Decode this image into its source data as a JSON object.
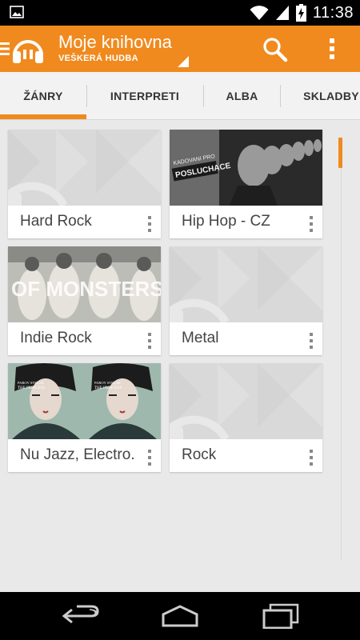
{
  "status_bar": {
    "time": "11:38",
    "icons": [
      "image-notification-icon",
      "wifi-icon",
      "cell-signal-icon",
      "battery-icon"
    ]
  },
  "action_bar": {
    "title": "Moje knihovna",
    "subtitle": "VEŠKERÁ HUDBA",
    "accent_color": "#f08a1e",
    "icons": [
      "drawer-icon",
      "headphones-logo-icon",
      "search-icon",
      "overflow-menu-icon"
    ]
  },
  "tabs": [
    {
      "label": "ŽÁNRY",
      "selected": true
    },
    {
      "label": "INTERPRETI",
      "selected": false
    },
    {
      "label": "ALBA",
      "selected": false
    },
    {
      "label": "SKLADBY",
      "selected": false
    }
  ],
  "genres": [
    {
      "label": "Hard Rock",
      "art": "placeholder"
    },
    {
      "label": "Hip Hop - CZ",
      "art": "album-cover"
    },
    {
      "label": "Indie Rock",
      "art": "album-cover"
    },
    {
      "label": "Metal",
      "art": "placeholder"
    },
    {
      "label": "Nu Jazz, Electro.",
      "art": "album-cover"
    },
    {
      "label": "Rock",
      "art": "placeholder"
    }
  ],
  "album_covers": {
    "hip_hop_cover_text": [
      "KADOVANI PRO",
      "POSLUCHACE"
    ],
    "indie_cover_text": "OF MONSTERS",
    "nujazz_cover_text": [
      "PAROV STELAR",
      "THE PRINCESS"
    ]
  },
  "nav_bar": {
    "icons": [
      "back-icon",
      "home-icon",
      "recent-apps-icon"
    ]
  }
}
